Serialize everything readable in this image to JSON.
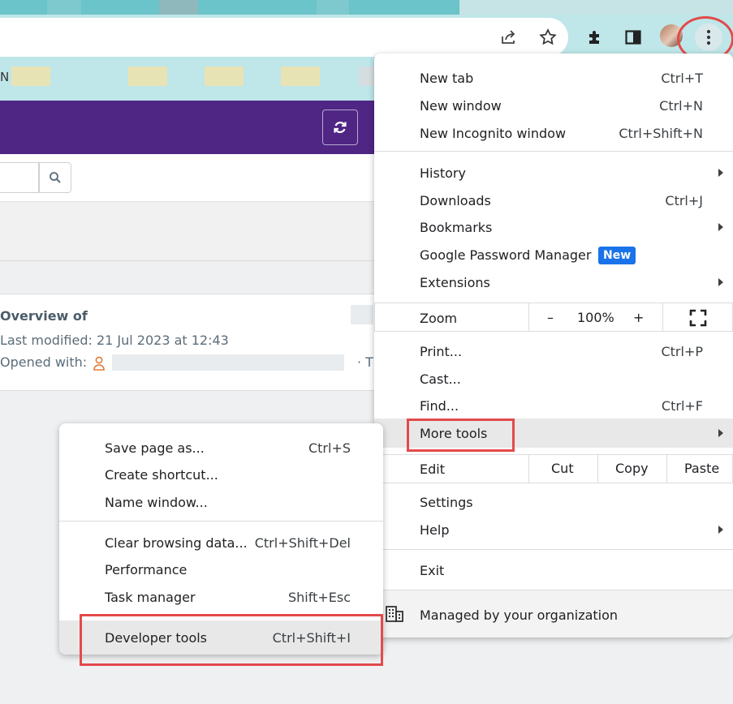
{
  "browser": {
    "bookmark_first_label": "N",
    "toolbar_icons": [
      "share-icon",
      "star-icon",
      "puzzle-icon",
      "side-panel-icon",
      "profile-avatar",
      "more-vert-icon"
    ]
  },
  "page": {
    "title": "Overview of",
    "last_modified": "Last modified: 21 Jul 2023 at 12:43",
    "opened_with": "Opened with:",
    "trailing": "· T",
    "colors": {
      "header": "#4f2684",
      "text": "#5b6d7a",
      "accent_person": "#e07b39"
    }
  },
  "main_menu": {
    "new_tab": {
      "label": "New tab",
      "shortcut": "Ctrl+T"
    },
    "new_window": {
      "label": "New window",
      "shortcut": "Ctrl+N"
    },
    "incognito": {
      "label": "New Incognito window",
      "shortcut": "Ctrl+Shift+N"
    },
    "history": {
      "label": "History"
    },
    "downloads": {
      "label": "Downloads",
      "shortcut": "Ctrl+J"
    },
    "bookmarks": {
      "label": "Bookmarks"
    },
    "password_manager": {
      "label": "Google Password Manager",
      "badge": "New"
    },
    "extensions": {
      "label": "Extensions"
    },
    "zoom": {
      "label": "Zoom",
      "minus": "–",
      "value": "100%",
      "plus": "+"
    },
    "print": {
      "label": "Print...",
      "shortcut": "Ctrl+P"
    },
    "cast": {
      "label": "Cast..."
    },
    "find": {
      "label": "Find...",
      "shortcut": "Ctrl+F"
    },
    "more_tools": {
      "label": "More tools"
    },
    "edit": {
      "label": "Edit",
      "cut": "Cut",
      "copy": "Copy",
      "paste": "Paste"
    },
    "settings": {
      "label": "Settings"
    },
    "help": {
      "label": "Help"
    },
    "exit": {
      "label": "Exit"
    },
    "managed": {
      "label": "Managed by your organization"
    }
  },
  "sub_menu": {
    "save_page": {
      "label": "Save page as...",
      "shortcut": "Ctrl+S"
    },
    "create_shortcut": {
      "label": "Create shortcut..."
    },
    "name_window": {
      "label": "Name window..."
    },
    "clear_data": {
      "label": "Clear browsing data...",
      "shortcut": "Ctrl+Shift+Del"
    },
    "performance": {
      "label": "Performance"
    },
    "task_manager": {
      "label": "Task manager",
      "shortcut": "Shift+Esc"
    },
    "dev_tools": {
      "label": "Developer tools",
      "shortcut": "Ctrl+Shift+I"
    }
  },
  "annotation": {
    "highlight_color": "#e34a4a"
  }
}
